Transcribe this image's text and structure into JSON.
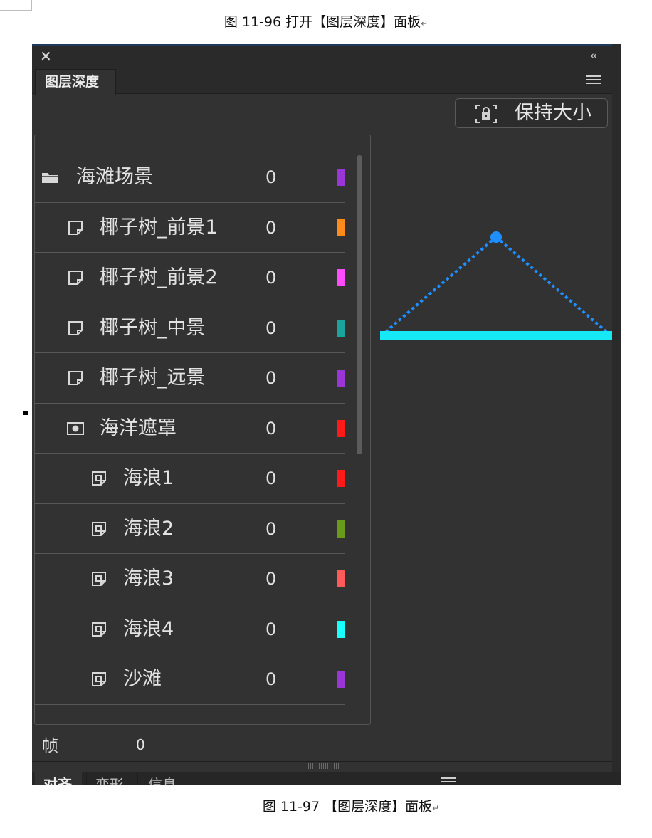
{
  "captions": {
    "top": "图 11-96  打开【图层深度】面板",
    "bottom": "图 11-97  【图层深度】面板"
  },
  "panel": {
    "close_glyph": "✕",
    "collapse_glyph": "‹‹",
    "tab": "图层深度",
    "keep_size": "保持大小",
    "frame_label": "帧",
    "frame_value": "0",
    "bottom_tabs": [
      "对齐",
      "变形",
      "信息"
    ]
  },
  "layers": [
    {
      "name": "海滩场景",
      "value": "0",
      "color": "#9b36d6",
      "icon": "folder-icon",
      "indent": 0
    },
    {
      "name": "椰子树_前景1",
      "value": "0",
      "color": "#ff8a1c",
      "icon": "layer-icon",
      "indent": 1
    },
    {
      "name": "椰子树_前景2",
      "value": "0",
      "color": "#ff4cff",
      "icon": "layer-icon",
      "indent": 1
    },
    {
      "name": "椰子树_中景",
      "value": "0",
      "color": "#1aa49a",
      "icon": "layer-icon",
      "indent": 1
    },
    {
      "name": "椰子树_远景",
      "value": "0",
      "color": "#9b36d6",
      "icon": "layer-icon",
      "indent": 1
    },
    {
      "name": "海洋遮罩",
      "value": "0",
      "color": "#ff1a1a",
      "icon": "mask-icon",
      "indent": 1
    },
    {
      "name": "海浪1",
      "value": "0",
      "color": "#ff1a1a",
      "icon": "masked-layer-icon",
      "indent": 2
    },
    {
      "name": "海浪2",
      "value": "0",
      "color": "#6a9a1c",
      "icon": "masked-layer-icon",
      "indent": 2
    },
    {
      "name": "海浪3",
      "value": "0",
      "color": "#ff5a5a",
      "icon": "masked-layer-icon",
      "indent": 2
    },
    {
      "name": "海浪4",
      "value": "0",
      "color": "#1affff",
      "icon": "masked-layer-icon",
      "indent": 2
    },
    {
      "name": "沙滩",
      "value": "0",
      "color": "#9b36d6",
      "icon": "masked-layer-icon",
      "indent": 2
    }
  ],
  "depth_graph": {
    "line_color": "#16e8f5",
    "point_color": "#1e8fff"
  }
}
